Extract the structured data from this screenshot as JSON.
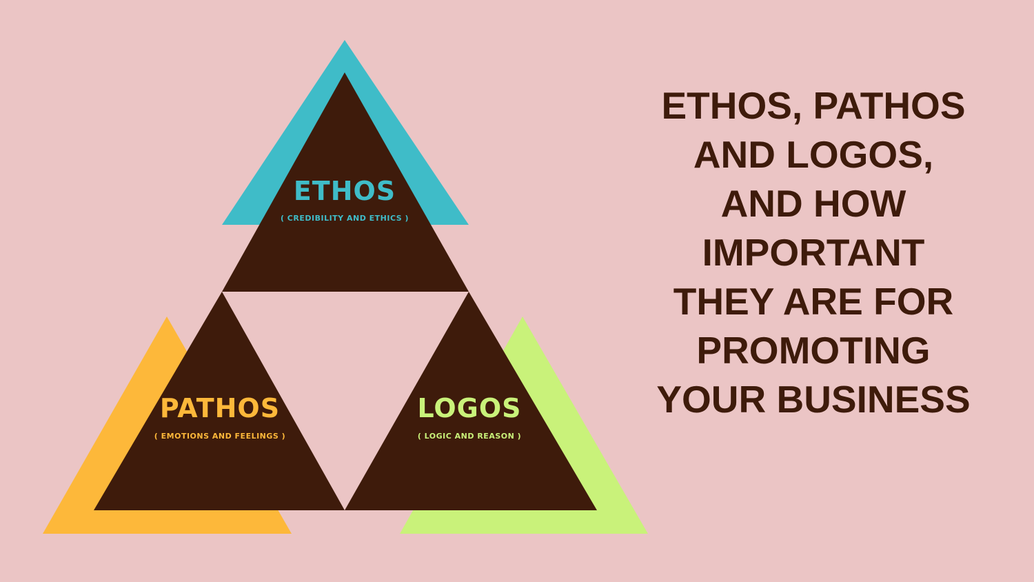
{
  "colors": {
    "background": "#ebc5c5",
    "dark": "#3e1b0b",
    "ethos": "#3fbcc8",
    "pathos": "#fdb83a",
    "logos": "#c9f27a"
  },
  "diagram": {
    "ethos": {
      "title": "ETHOS",
      "subtitle": "( CREDIBILITY AND ETHICS )"
    },
    "pathos": {
      "title": "PATHOS",
      "subtitle": "( EMOTIONS AND FEELINGS )"
    },
    "logos": {
      "title": "LOGOS",
      "subtitle": "( LOGIC AND REASON )"
    }
  },
  "headline": {
    "lines": [
      "ETHOS, PATHOS",
      "AND LOGOS,",
      "AND HOW",
      "IMPORTANT",
      "THEY ARE FOR",
      "PROMOTING",
      "YOUR BUSINESS"
    ]
  }
}
